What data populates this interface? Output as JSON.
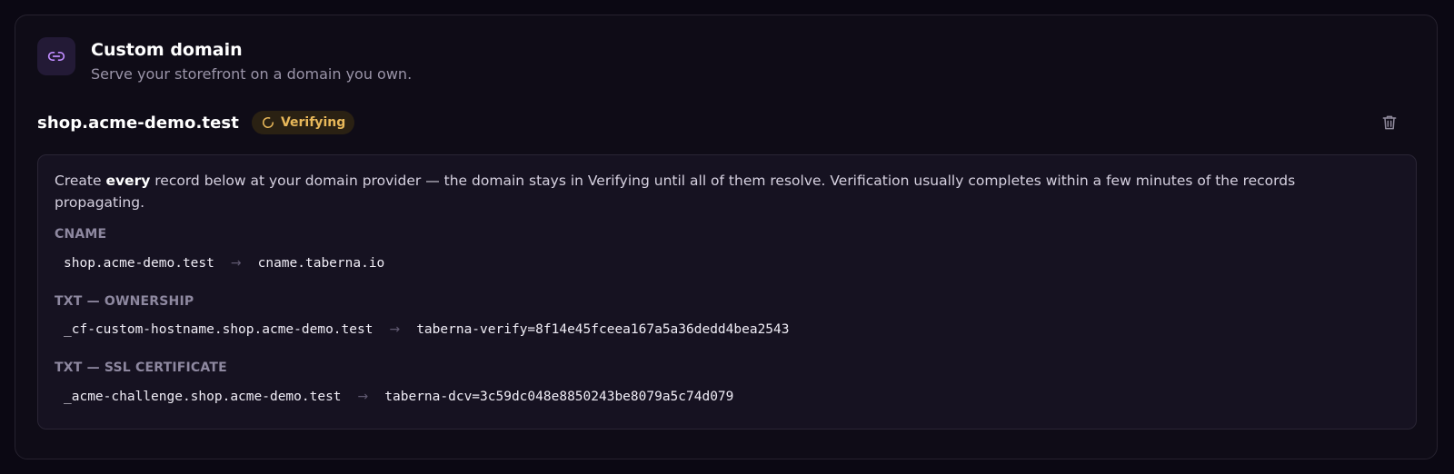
{
  "header": {
    "title": "Custom domain",
    "subtitle": "Serve your storefront on a domain you own."
  },
  "domain": {
    "name": "shop.acme-demo.test",
    "status": "Verifying",
    "status_color": "#e8b85a"
  },
  "instructions": {
    "before": "Create ",
    "emphasis": "every",
    "after": " record below at your domain provider — the domain stays in Verifying until all of them resolve. Verification usually completes within a few minutes of the records propagating."
  },
  "records": [
    {
      "label": "CNAME",
      "name": "shop.acme-demo.test",
      "arrow": "→",
      "value": "cname.taberna.io"
    },
    {
      "label": "TXT — OWNERSHIP",
      "name": "_cf-custom-hostname.shop.acme-demo.test",
      "arrow": "→",
      "value": "taberna-verify=8f14e45fceea167a5a36dedd4bea2543"
    },
    {
      "label": "TXT — SSL CERTIFICATE",
      "name": "_acme-challenge.shop.acme-demo.test",
      "arrow": "→",
      "value": "taberna-dcv=3c59dc048e8850243be8079a5c74d079"
    }
  ],
  "icons": {
    "header": "link-icon",
    "status": "spinner-icon",
    "delete": "trash-icon"
  },
  "colors": {
    "accent": "#c08cff",
    "background": "#0b0813"
  }
}
